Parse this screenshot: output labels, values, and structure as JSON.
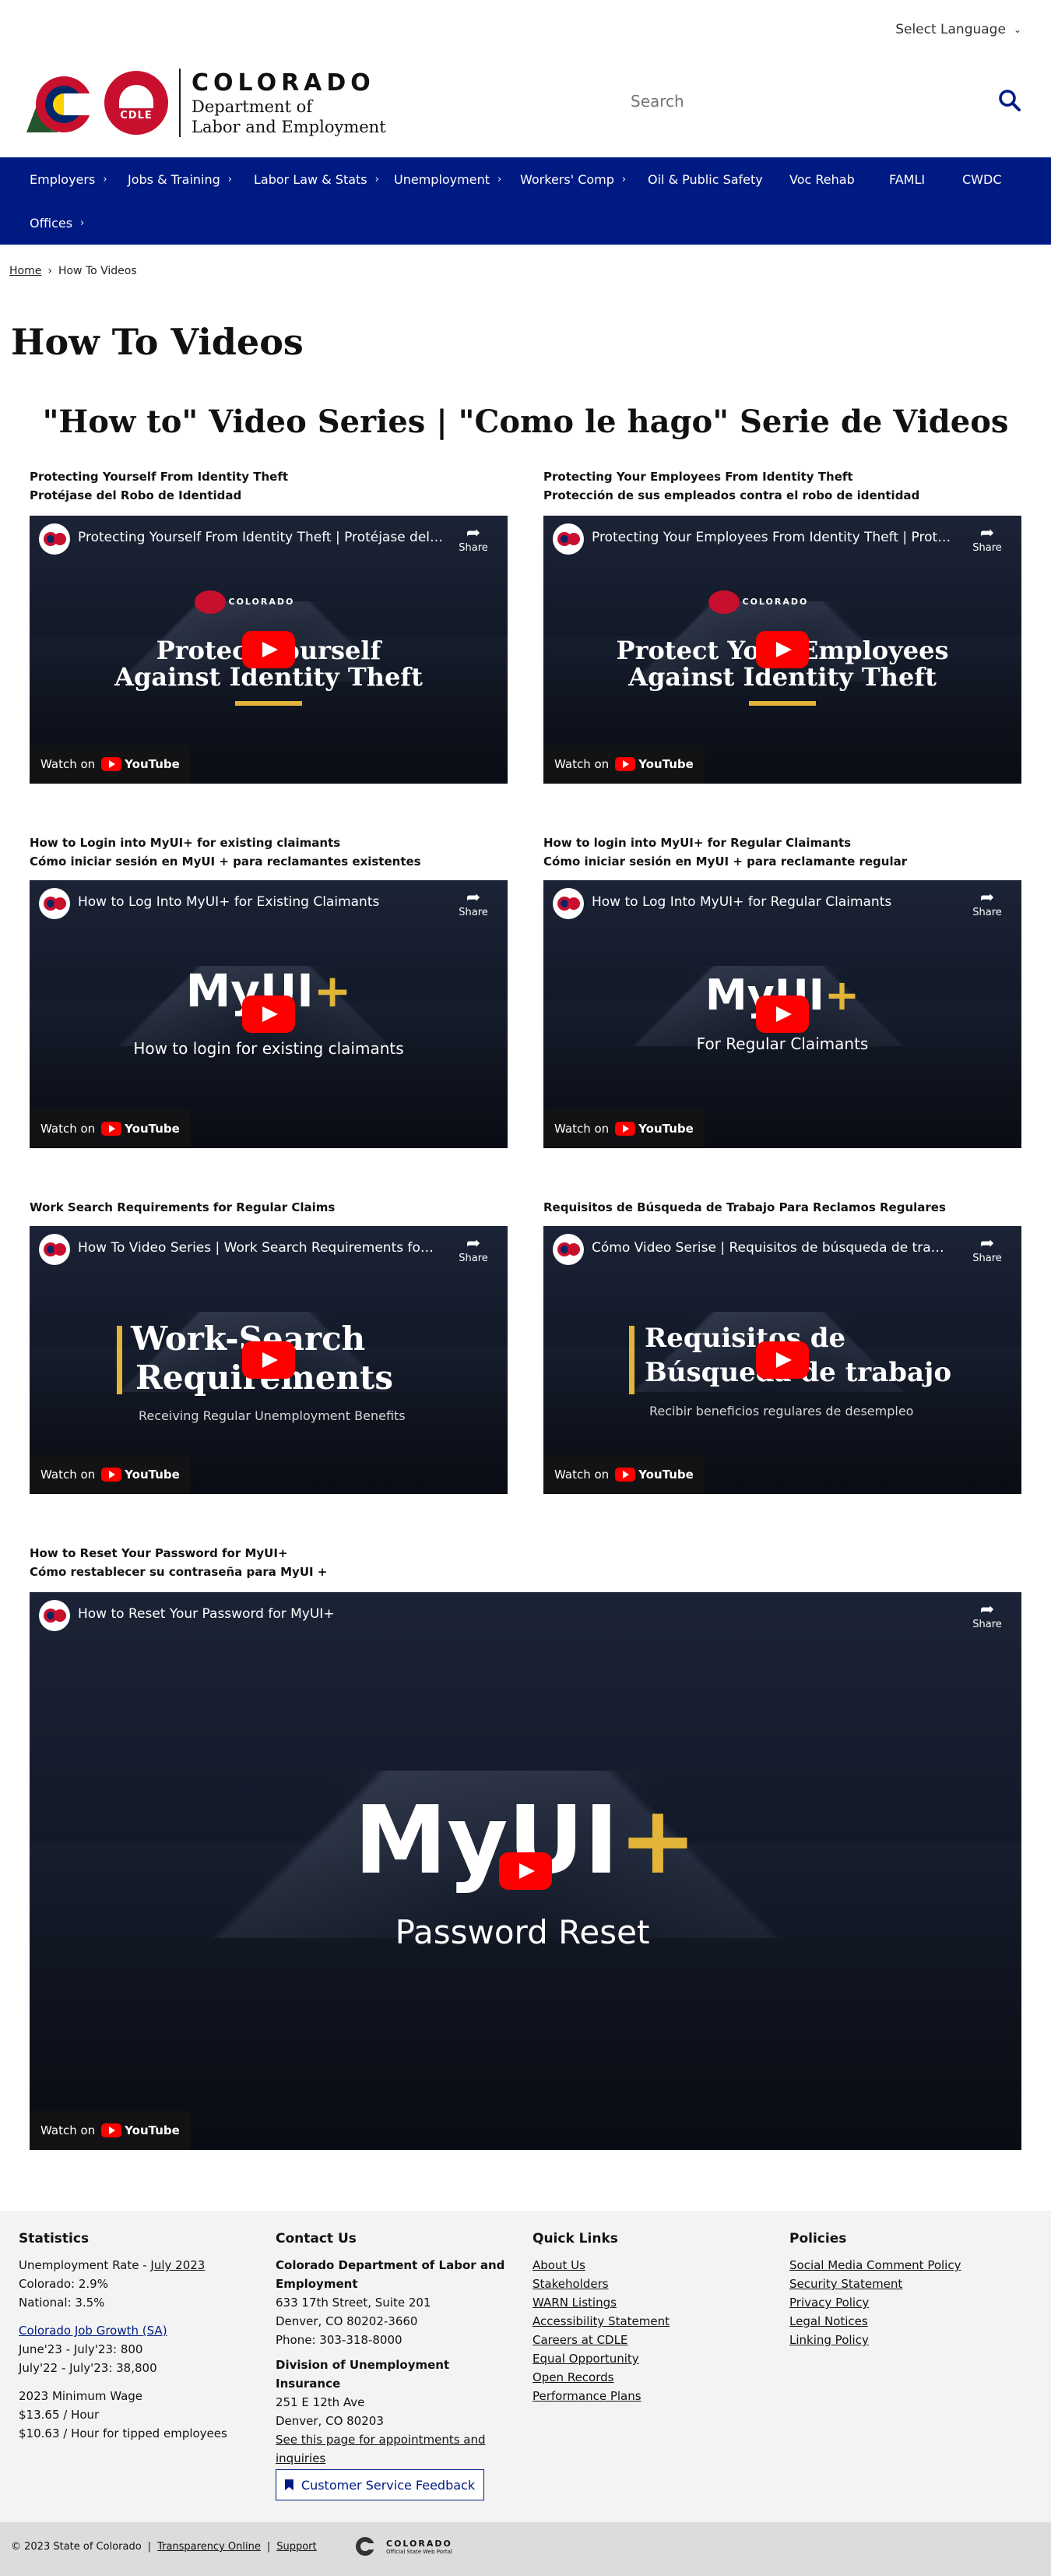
{
  "header": {
    "language_label": "Select Language",
    "brand_title": "COLORADO",
    "brand_line1": "Department of",
    "brand_line2": "Labor and Employment",
    "logo_badge": "CDLE",
    "search_placeholder": "Search"
  },
  "nav": {
    "items": [
      {
        "label": "Employers"
      },
      {
        "label": "Jobs & Training"
      },
      {
        "label": "Labor Law & Stats"
      },
      {
        "label": "Unemployment"
      },
      {
        "label": "Workers' Comp"
      },
      {
        "label": "Oil & Public Safety"
      },
      {
        "label": "Voc Rehab"
      },
      {
        "label": "FAMLI"
      },
      {
        "label": "CWDC"
      },
      {
        "label": "Offices"
      }
    ]
  },
  "breadcrumb": {
    "home": "Home",
    "separator": "›",
    "current": "How To Videos"
  },
  "page_title": "How To Videos",
  "section_title": "\"How to\" Video Series | \"Como le hago\" Serie de Videos",
  "videos": [
    {
      "caption1": "Protecting Yourself From Identity Theft",
      "caption2": "Protéjase del Robo de Identidad",
      "title": "Protecting Yourself From Identity Theft | Protéjase del Ro...",
      "big_line1": "Protect Yourself",
      "big_line2": "Against Identity Theft"
    },
    {
      "caption1": "Protecting Your Employees From Identity Theft",
      "caption2": "Protección de sus empleados contra el robo de identidad",
      "title": "Protecting Your Employees From Identity Theft | Protecci...",
      "big_line1": "Protect Your Employees",
      "big_line2": "Against Identity Theft"
    },
    {
      "caption1": "How to Login into MyUI+ for existing claimants",
      "caption2": "Cómo iniciar sesión en MyUI + para reclamantes existentes",
      "title": "How to Log Into MyUI+ for Existing Claimants",
      "big_line1": "MyUI",
      "sub": "How to login for existing claimants"
    },
    {
      "caption1": "How to login into MyUI+ for Regular Claimants",
      "caption2": "Cómo iniciar sesión en MyUI + para reclamante regular",
      "title": "How to Log Into MyUI+ for Regular Claimants",
      "big_line1": "MyUI",
      "sub": "For Regular Claimants"
    },
    {
      "caption1": "Work Search Requirements for Regular Claims",
      "title": "How To Video Series | Work Search Requirements for Reg...",
      "big_line1": "Work-Search",
      "big_line2": "Requirements",
      "sub": "Receiving Regular Unemployment Benefits"
    },
    {
      "caption1": "Requisitos de Búsqueda de Trabajo Para Reclamos Regulares",
      "title": "Cómo Video Serise | Requisitos de búsqueda de trabajo ...",
      "big_line1": "Requisitos de",
      "big_line2": "Búsqueda de trabajo",
      "sub": "Recibir beneficios regulares de desempleo"
    },
    {
      "caption1": "How to Reset Your Password for MyUI+",
      "caption2": "Cómo restablecer su contraseña para MyUI +",
      "title": "How to Reset Your Password for MyUI+",
      "big_line1": "MyUI",
      "sub": "Password Reset"
    }
  ],
  "video_common": {
    "share": "Share",
    "watch_on": "Watch on",
    "youtube": "YouTube",
    "plus": "+",
    "co_mini_title": "COLORADO",
    "co_mini_sub1": "Department of",
    "co_mini_sub2": "Labor and Employment"
  },
  "footer": {
    "stats": {
      "heading": "Statistics",
      "unemp_prefix": "Unemployment Rate - ",
      "unemp_link": "July 2023",
      "colorado": "Colorado: 2.9%",
      "national": "National: 3.5%",
      "growth_link": "Colorado Job Growth (SA)",
      "growth1": "June'23 - July'23: 800",
      "growth2": "July'22 - July'23: 38,800",
      "wage_title": "2023 Minimum Wage",
      "wage1": "$13.65 / Hour",
      "wage2": "$10.63 / Hour for tipped employees"
    },
    "contact": {
      "heading": "Contact Us",
      "org1": "Colorado Department of Labor and",
      "org2": "Employment",
      "addr1": "633 17th Street, Suite 201",
      "addr2": "Denver, CO  80202-3660",
      "phone": "Phone: 303-318-8000",
      "div": "Division of Unemployment Insurance",
      "div_addr1": "251 E 12th Ave",
      "div_addr2": "Denver, CO  80203",
      "appt1": "See this page for appointments and",
      "appt2": "inquiries",
      "feedback": "Customer Service Feedback"
    },
    "quick": {
      "heading": "Quick Links",
      "links": [
        "About Us",
        "Stakeholders",
        "WARN Listings",
        "Accessibility Statement",
        "Careers at CDLE",
        "Equal Opportunity",
        "Open Records",
        "Performance Plans"
      ]
    },
    "policies": {
      "heading": "Policies",
      "links": [
        "Social Media Comment Policy",
        "Security Statement",
        "Privacy Policy",
        "Legal Notices",
        "Linking Policy"
      ]
    },
    "bottom": {
      "copyright": "© 2023 State of Colorado",
      "sep": "|",
      "transparency": "Transparency Online",
      "support": "Support",
      "logo_title": "COLORADO",
      "logo_sub": "Official State Web Portal"
    }
  }
}
